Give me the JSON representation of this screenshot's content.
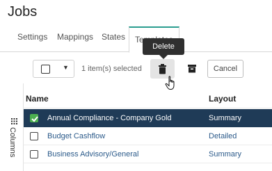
{
  "page": {
    "title": "Jobs"
  },
  "tabs": [
    {
      "label": "Settings"
    },
    {
      "label": "Mappings"
    },
    {
      "label": "States"
    },
    {
      "label": "Templates"
    }
  ],
  "toolbar": {
    "selection_text": "1 item(s) selected",
    "delete_tooltip": "Delete",
    "cancel_label": "Cancel"
  },
  "side_panel": {
    "label": "Columns"
  },
  "table": {
    "columns": [
      "Name",
      "Layout"
    ],
    "rows": [
      {
        "name": "Annual Compliance - Company Gold",
        "layout": "Summary",
        "selected": true
      },
      {
        "name": "Budget Cashflow",
        "layout": "Detailed",
        "selected": false
      },
      {
        "name": "Business Advisory/General",
        "layout": "Summary",
        "selected": false
      }
    ]
  },
  "colors": {
    "accent": "#2a9d8f",
    "selected_row": "#1f3b57",
    "checkbox_checked": "#4caf50",
    "link": "#2b5a8a"
  },
  "icons": [
    "chevron-down-icon",
    "trash-icon",
    "archive-icon",
    "hand-pointer-icon",
    "grid-icon",
    "check-icon"
  ]
}
